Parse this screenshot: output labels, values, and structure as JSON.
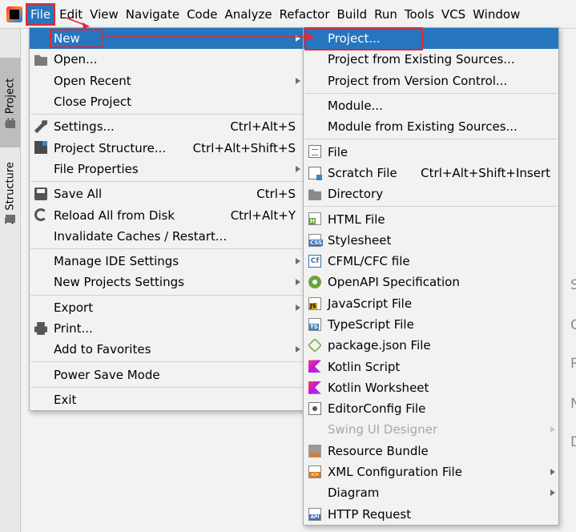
{
  "menubar": {
    "items": [
      "File",
      "Edit",
      "View",
      "Navigate",
      "Code",
      "Analyze",
      "Refactor",
      "Build",
      "Run",
      "Tools",
      "VCS",
      "Window"
    ]
  },
  "toolstrip": {
    "project_tab": "1: Project",
    "structure_tab": "Z: Structure"
  },
  "file_menu": {
    "new": "New",
    "open": "Open...",
    "open_recent": "Open Recent",
    "close_project": "Close Project",
    "settings": "Settings...",
    "settings_sc": "Ctrl+Alt+S",
    "project_structure": "Project Structure...",
    "project_structure_sc": "Ctrl+Alt+Shift+S",
    "file_properties": "File Properties",
    "save_all": "Save All",
    "save_all_sc": "Ctrl+S",
    "reload": "Reload All from Disk",
    "reload_sc": "Ctrl+Alt+Y",
    "invalidate": "Invalidate Caches / Restart...",
    "manage_ide": "Manage IDE Settings",
    "new_projects": "New Projects Settings",
    "export": "Export",
    "print": "Print...",
    "favorites": "Add to Favorites",
    "power_save": "Power Save Mode",
    "exit": "Exit"
  },
  "new_menu": {
    "project": "Project...",
    "project_existing": "Project from Existing Sources...",
    "project_vcs": "Project from Version Control...",
    "module": "Module...",
    "module_existing": "Module from Existing Sources...",
    "file": "File",
    "scratch": "Scratch File",
    "scratch_sc": "Ctrl+Alt+Shift+Insert",
    "directory": "Directory",
    "html": "HTML File",
    "stylesheet": "Stylesheet",
    "cfml": "CFML/CFC file",
    "openapi": "OpenAPI Specification",
    "javascript": "JavaScript File",
    "typescript": "TypeScript File",
    "package_json": "package.json File",
    "kotlin_script": "Kotlin Script",
    "kotlin_worksheet": "Kotlin Worksheet",
    "editorconfig": "EditorConfig File",
    "swing": "Swing UI Designer",
    "resource_bundle": "Resource Bundle",
    "xml_config": "XML Configuration File",
    "diagram": "Diagram",
    "http_request": "HTTP Request"
  },
  "icon_badges": {
    "html": "H",
    "css": "CSS",
    "cf": "Cf",
    "js": "JS",
    "ts": "TS",
    "xml": "<>",
    "api": "API"
  },
  "editor_letters": [
    "S",
    "G",
    "R",
    "N",
    "D"
  ],
  "colors": {
    "highlight": "#2675bf",
    "annotation_red": "#e8262d",
    "background": "#f2f2f2"
  }
}
